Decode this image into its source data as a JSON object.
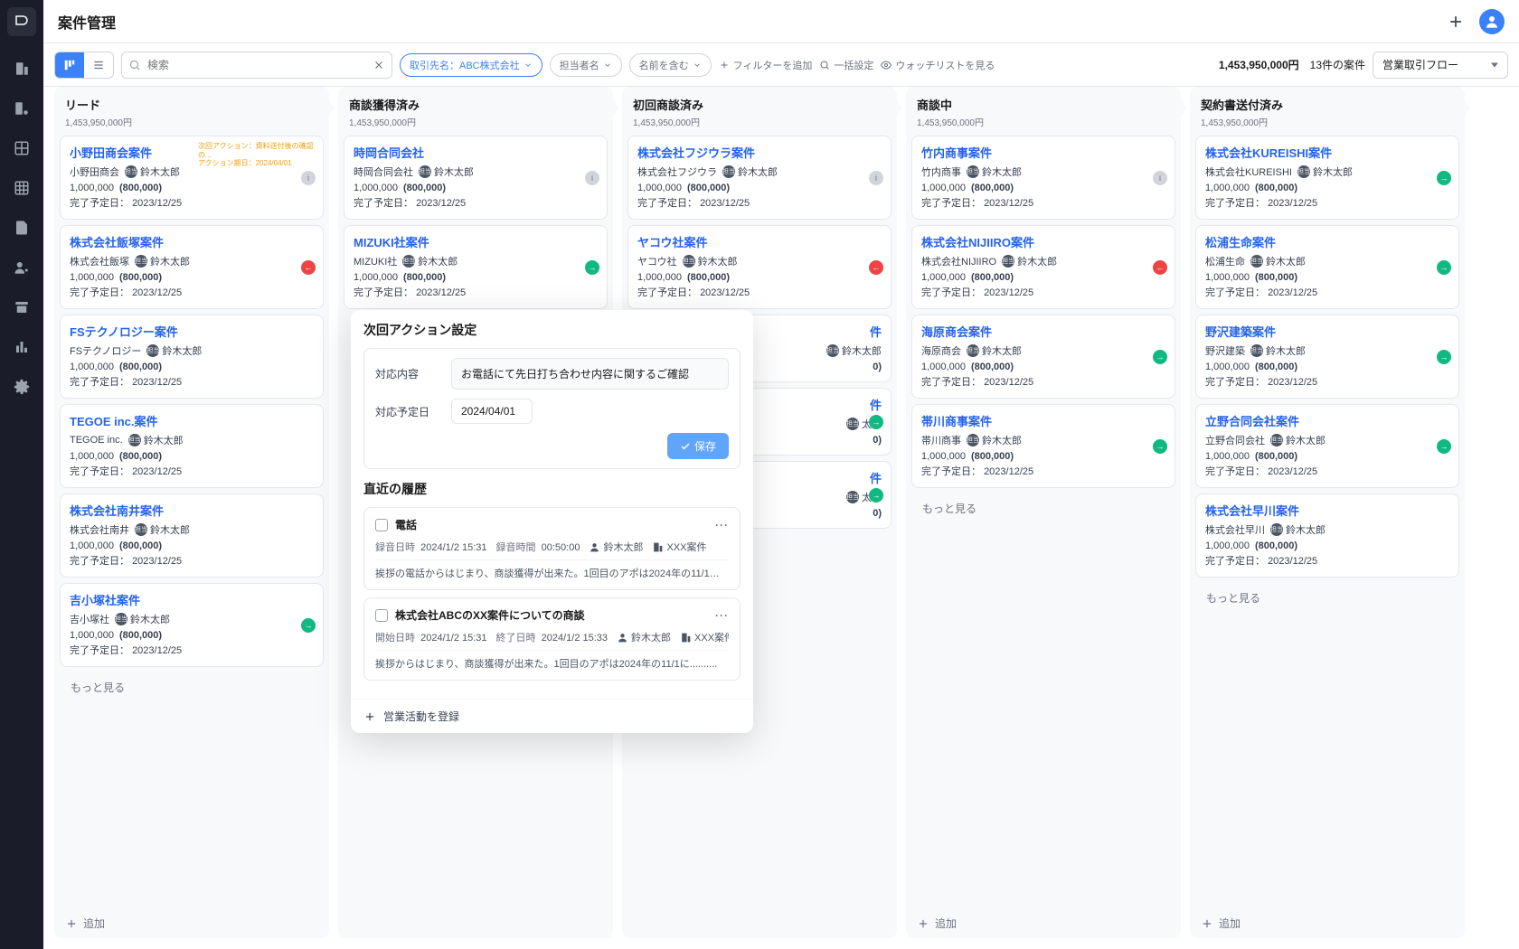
{
  "header": {
    "title": "案件管理"
  },
  "toolbar": {
    "search_placeholder": "検索",
    "filter_client": "取引先名：ABC株式会社",
    "filter_owner": "担当者名",
    "filter_name_contains": "名前を含む",
    "add_filter": "フィルターを追加",
    "bulk_config": "一括設定",
    "watchlist": "ウォッチリストを見る",
    "total_amount": "1,453,950,000円",
    "total_count": "13件の案件",
    "flow_select": "営業取引フロー"
  },
  "columns": [
    {
      "title": "リード",
      "amount": "1,453,950,000円",
      "show_more": true,
      "show_add": true,
      "cards": [
        {
          "title": "小野田商会案件",
          "company": "小野田商会",
          "owner": "鈴木太郎",
          "amount": "1,000,000",
          "paren": "(800,000)",
          "due_label": "完了予定日：",
          "due": "2023/12/25",
          "note_line1": "次回アクション：資料送付後の確認の...",
          "note_line2": "アクション期日：2024/04/01",
          "indicator": "gray"
        },
        {
          "title": "株式会社飯塚案件",
          "company": "株式会社飯塚",
          "owner": "鈴木太郎",
          "amount": "1,000,000",
          "paren": "(800,000)",
          "due_label": "完了予定日：",
          "due": "2023/12/25",
          "indicator": "red"
        },
        {
          "title": "FSテクノロジー案件",
          "company": "FSテクノロジー",
          "owner": "鈴木太郎",
          "amount": "1,000,000",
          "paren": "(800,000)",
          "due_label": "完了予定日：",
          "due": "2023/12/25"
        },
        {
          "title": "TEGOE inc.案件",
          "company": "TEGOE inc.",
          "owner": "鈴木太郎",
          "amount": "1,000,000",
          "paren": "(800,000)",
          "due_label": "完了予定日：",
          "due": "2023/12/25"
        },
        {
          "title": "株式会社南井案件",
          "company": "株式会社南井",
          "owner": "鈴木太郎",
          "amount": "1,000,000",
          "paren": "(800,000)",
          "due_label": "完了予定日：",
          "due": "2023/12/25"
        },
        {
          "title": "吉小塚社案件",
          "company": "吉小塚社",
          "owner": "鈴木太郎",
          "amount": "1,000,000",
          "paren": "(800,000)",
          "due_label": "完了予定日：",
          "due": "2023/12/25",
          "indicator": "green"
        }
      ]
    },
    {
      "title": "商談獲得済み",
      "amount": "1,453,950,000円",
      "cards": [
        {
          "title": "時岡合同会社",
          "company": "時岡合同会社",
          "owner": "鈴木太郎",
          "amount": "1,000,000",
          "paren": "(800,000)",
          "due_label": "完了予定日：",
          "due": "2023/12/25",
          "indicator": "gray"
        },
        {
          "title": "MIZUKI社案件",
          "company": "MIZUKI社",
          "owner": "鈴木太郎",
          "amount": "1,000,000",
          "paren": "(800,000)",
          "due_label": "完了予定日：",
          "due": "2023/12/25",
          "indicator": "green"
        }
      ]
    },
    {
      "title": "初回商談済み",
      "amount": "1,453,950,000円",
      "cards": [
        {
          "title": "株式会社フジウラ案件",
          "company": "株式会社フジウラ",
          "owner": "鈴木太郎",
          "amount": "1,000,000",
          "paren": "(800,000)",
          "due_label": "完了予定日：",
          "due": "2023/12/25",
          "indicator": "gray"
        },
        {
          "title": "ヤコウ社案件",
          "company": "ヤコウ社",
          "owner": "鈴木太郎",
          "amount": "1,000,000",
          "paren": "(800,000)",
          "due_label": "完了予定日：",
          "due": "2023/12/25",
          "indicator": "red"
        },
        {
          "title": "件",
          "company": "",
          "owner": "鈴木太郎",
          "amount": "",
          "paren": "0)",
          "due_label": "",
          "due": "",
          "partial": true
        },
        {
          "title": "件",
          "company": "",
          "owner": "太郎",
          "amount": "",
          "paren": "0)",
          "due_label": "",
          "due": "",
          "partial": true,
          "indicator": "green"
        },
        {
          "title": "件",
          "company": "",
          "owner": "太郎",
          "amount": "",
          "paren": "0)",
          "due_label": "",
          "due": "",
          "partial": true,
          "indicator": "green"
        }
      ]
    },
    {
      "title": "商談中",
      "amount": "1,453,950,000円",
      "show_more": true,
      "show_add": true,
      "cards": [
        {
          "title": "竹内商事案件",
          "company": "竹内商事",
          "owner": "鈴木太郎",
          "amount": "1,000,000",
          "paren": "(800,000)",
          "due_label": "完了予定日：",
          "due": "2023/12/25",
          "indicator": "gray"
        },
        {
          "title": "株式会社NIJIIRO案件",
          "company": "株式会社NIJIIRO",
          "owner": "鈴木太郎",
          "amount": "1,000,000",
          "paren": "(800,000)",
          "due_label": "完了予定日：",
          "due": "2023/12/25",
          "indicator": "red"
        },
        {
          "title": "海原商会案件",
          "company": "海原商会",
          "owner": "鈴木太郎",
          "amount": "1,000,000",
          "paren": "(800,000)",
          "due_label": "完了予定日：",
          "due": "2023/12/25",
          "indicator": "green"
        },
        {
          "title": "帯川商事案件",
          "company": "帯川商事",
          "owner": "鈴木太郎",
          "amount": "1,000,000",
          "paren": "(800,000)",
          "due_label": "完了予定日：",
          "due": "2023/12/25",
          "indicator": "green"
        }
      ]
    },
    {
      "title": "契約書送付済み",
      "amount": "1,453,950,000円",
      "show_more": true,
      "show_add": true,
      "cards": [
        {
          "title": "株式会社KUREISHI案件",
          "company": "株式会社KUREISHI",
          "owner": "鈴木太郎",
          "amount": "1,000,000",
          "paren": "(800,000)",
          "due_label": "完了予定日：",
          "due": "2023/12/25",
          "indicator": "green"
        },
        {
          "title": "松浦生命案件",
          "company": "松浦生命",
          "owner": "鈴木太郎",
          "amount": "1,000,000",
          "paren": "(800,000)",
          "due_label": "完了予定日：",
          "due": "2023/12/25",
          "indicator": "green"
        },
        {
          "title": "野沢建築案件",
          "company": "野沢建築",
          "owner": "鈴木太郎",
          "amount": "1,000,000",
          "paren": "(800,000)",
          "due_label": "完了予定日：",
          "due": "2023/12/25",
          "indicator": "green"
        },
        {
          "title": "立野合同会社案件",
          "company": "立野合同会社",
          "owner": "鈴木太郎",
          "amount": "1,000,000",
          "paren": "(800,000)",
          "due_label": "完了予定日：",
          "due": "2023/12/25",
          "indicator": "green"
        },
        {
          "title": "株式会社早川案件",
          "company": "株式会社早川",
          "owner": "鈴木太郎",
          "amount": "1,000,000",
          "paren": "(800,000)",
          "due_label": "完了予定日：",
          "due": "2023/12/25"
        }
      ]
    }
  ],
  "labels": {
    "more": "もっと見る",
    "add": "追加",
    "owner_badge": "担当"
  },
  "popover": {
    "action_title": "次回アクション設定",
    "content_label": "対応内容",
    "content_value": "お電話にて先日打ち合わせ内容に関するご確認",
    "date_label": "対応予定日",
    "date_value": "2024/04/01",
    "save": "保存",
    "history_title": "直近の履歴",
    "history": [
      {
        "title": "電話",
        "meta": [
          {
            "label": "録音日時",
            "value": "2024/1/2 15:31"
          },
          {
            "label": "録音時間",
            "value": "00:50:00"
          }
        ],
        "owner": "鈴木太郎",
        "deal": "XXX案件",
        "body": "挨拶の電話からはじまり、商談獲得が出来た。1回目のアポは2024年の11/1に........."
      },
      {
        "title": "株式会社ABCのXX案件についての商談",
        "meta": [
          {
            "label": "開始日時",
            "value": "2024/1/2 15:31"
          },
          {
            "label": "終了日時",
            "value": "2024/1/2 15:33"
          }
        ],
        "owner": "鈴木太郎",
        "deal": "XXX案件",
        "body": "挨拶からはじまり、商談獲得が出来た。1回目のアポは2024年の11/1に.........."
      }
    ],
    "register": "営業活動を登録"
  }
}
